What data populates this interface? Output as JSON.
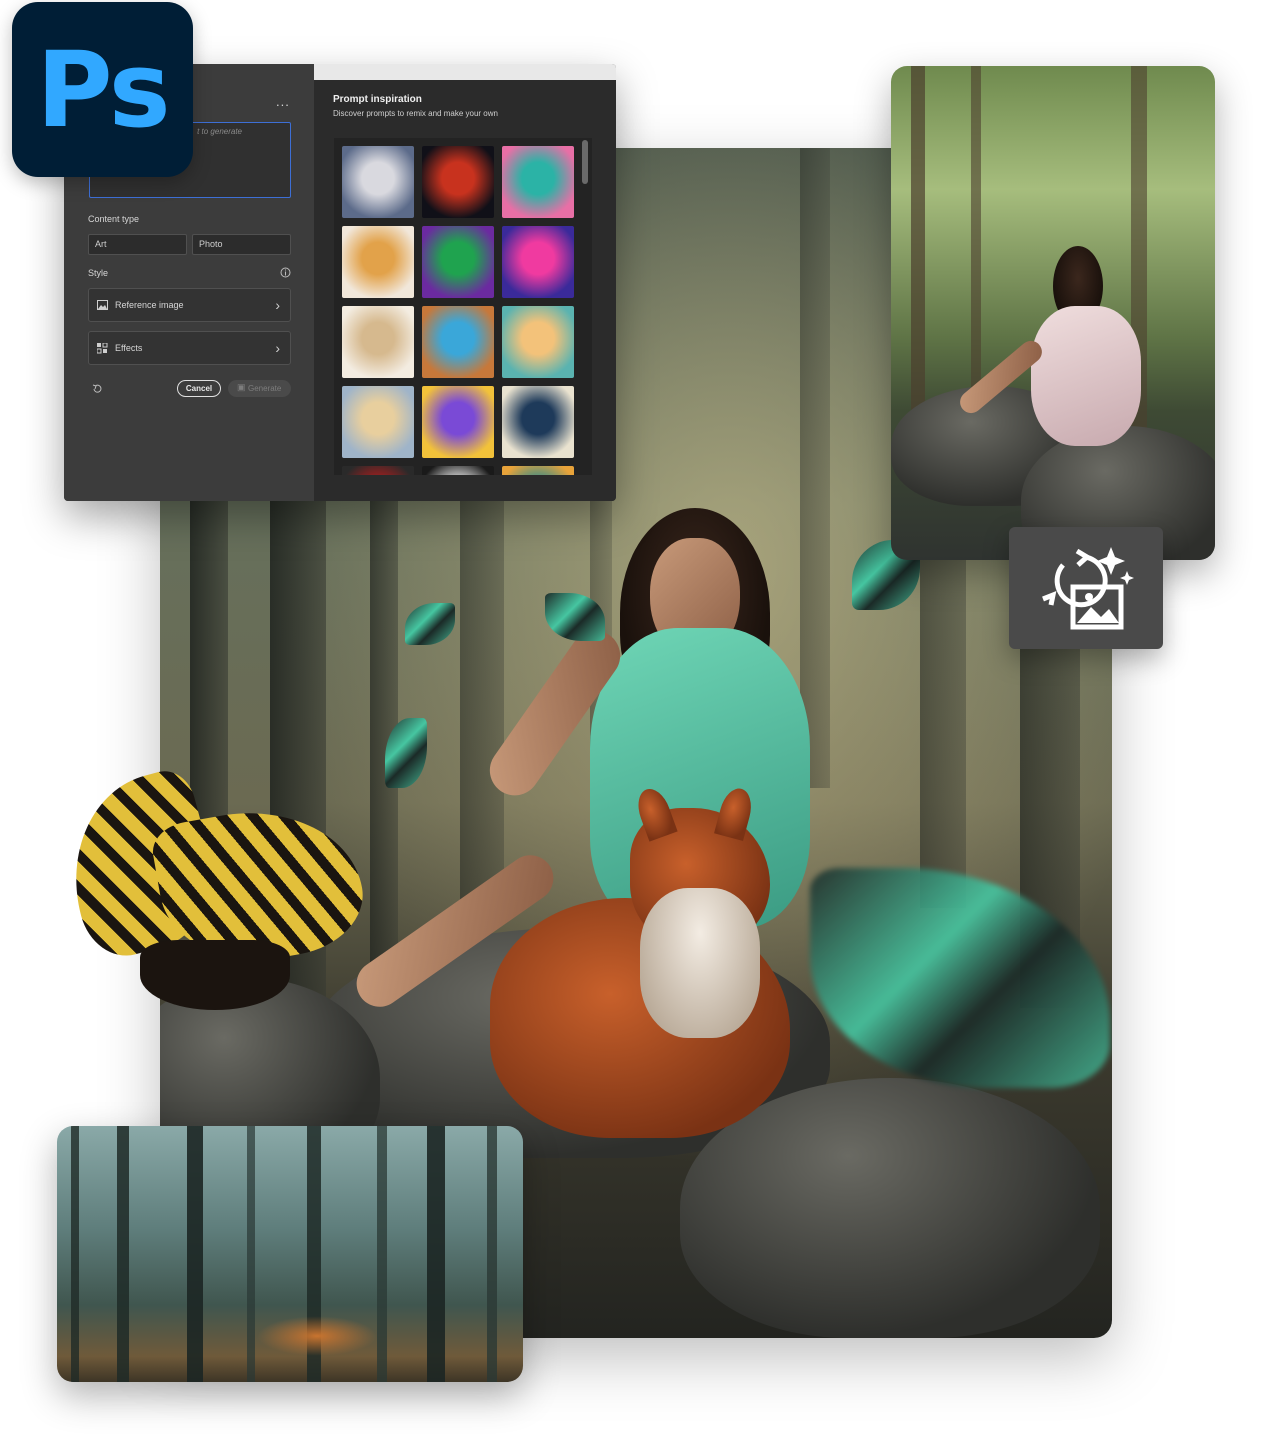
{
  "logo": {
    "text": "Ps"
  },
  "panel": {
    "more_label": "...",
    "prompt_placeholder": "t to generate",
    "content_type_label": "Content type",
    "content_type_options": [
      "Art",
      "Photo"
    ],
    "style_label": "Style",
    "reference_image_label": "Reference image",
    "effects_label": "Effects",
    "cancel_label": "Cancel",
    "generate_label": "Generate"
  },
  "inspiration": {
    "title": "Prompt inspiration",
    "subtitle": "Discover prompts to remix and make your own",
    "thumbnails": [
      {
        "name": "winter-house",
        "colors": [
          "#d9d9df",
          "#5c6b8a"
        ]
      },
      {
        "name": "red-moon",
        "colors": [
          "#c8321e",
          "#101018"
        ]
      },
      {
        "name": "peacock-feather",
        "colors": [
          "#2bb3a6",
          "#e86fa6"
        ]
      },
      {
        "name": "leopard",
        "colors": [
          "#e2a24a",
          "#f1e7da"
        ]
      },
      {
        "name": "astronaut",
        "colors": [
          "#1fa34f",
          "#6b2aa0"
        ]
      },
      {
        "name": "neon-dog",
        "colors": [
          "#f03aa0",
          "#3a2a9a"
        ]
      },
      {
        "name": "paper-desk",
        "colors": [
          "#d6b98e",
          "#f3ece1"
        ]
      },
      {
        "name": "woman-portrait",
        "colors": [
          "#3aa7d9",
          "#c7783a"
        ]
      },
      {
        "name": "sun-waves",
        "colors": [
          "#f3c27a",
          "#5ab3b0"
        ]
      },
      {
        "name": "desert-castle",
        "colors": [
          "#e8cf9e",
          "#9fb4c9"
        ]
      },
      {
        "name": "cat-pop",
        "colors": [
          "#7a4ad6",
          "#f2c23a"
        ]
      },
      {
        "name": "lighthouse-wave",
        "colors": [
          "#1e3a5a",
          "#e9e2cf"
        ]
      },
      {
        "name": "partial-red",
        "colors": [
          "#b21d1d",
          "#2a2a2a"
        ]
      },
      {
        "name": "partial-bw",
        "colors": [
          "#f0f0f0",
          "#1a1a1a"
        ]
      },
      {
        "name": "partial-teal",
        "colors": [
          "#2a8a8f",
          "#e8a33a"
        ]
      }
    ]
  }
}
